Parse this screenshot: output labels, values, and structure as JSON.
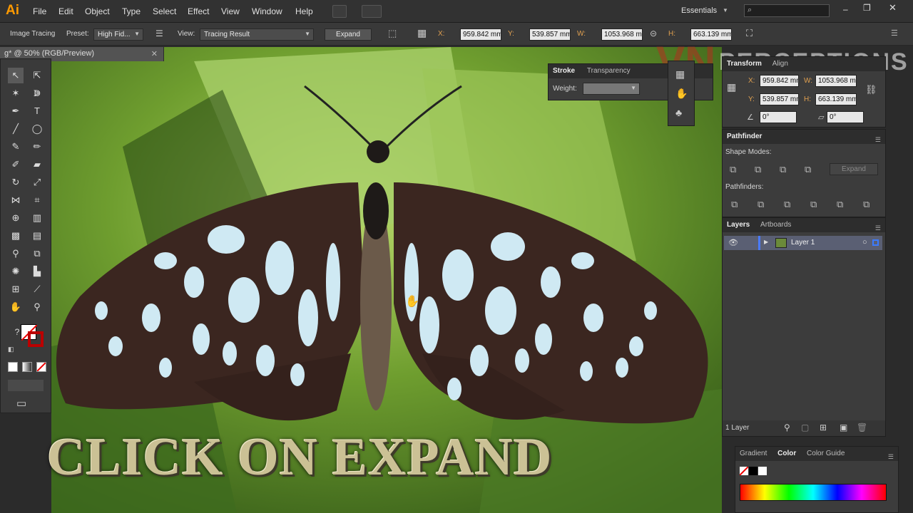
{
  "app": {
    "logo": "Ai",
    "workspace": "Essentials"
  },
  "menu": [
    "File",
    "Edit",
    "Object",
    "Type",
    "Select",
    "Effect",
    "View",
    "Window",
    "Help"
  ],
  "controlbar": {
    "mode_label": "Image Tracing",
    "preset_label": "Preset:",
    "preset_value": "High Fid...",
    "view_label": "View:",
    "view_value": "Tracing Result",
    "expand_label": "Expand",
    "x_label": "X:",
    "x_value": "959.842 mm",
    "y_label": "Y:",
    "y_value": "539.857 mm",
    "w_label": "W:",
    "w_value": "1053.968 m",
    "h_label": "H:",
    "h_value": "663.139 mm"
  },
  "document": {
    "tab_title": "g* @ 50% (RGB/Preview)"
  },
  "stroke_panel": {
    "tab_stroke": "Stroke",
    "tab_transparency": "Transparency",
    "weight_label": "Weight:"
  },
  "transform_panel": {
    "tab_transform": "Transform",
    "tab_align": "Align",
    "x_label": "X:",
    "x_value": "959.842 mm",
    "y_label": "Y:",
    "y_value": "539.857 mm",
    "w_label": "W:",
    "w_value": "1053.968 m",
    "h_label": "H:",
    "h_value": "663.139 mm",
    "angle_value": "0°",
    "shear_value": "0°"
  },
  "pathfinder_panel": {
    "title": "Pathfinder",
    "shape_modes_label": "Shape Modes:",
    "expand_label": "Expand",
    "pathfinders_label": "Pathfinders:"
  },
  "layers_panel": {
    "tab_layers": "Layers",
    "tab_artboards": "Artboards",
    "layer_name": "Layer 1",
    "footer": "1 Layer"
  },
  "color_panel": {
    "tab_gradient": "Gradient",
    "tab_color": "Color",
    "tab_color_guide": "Color Guide"
  },
  "overlay": {
    "caption": "CLICK ON EXPAND",
    "watermark_vn": "VN",
    "watermark_text": "PERCEPTIONS"
  },
  "colors": {
    "accent": "#ff9a00",
    "ui_dark": "#323232",
    "selection_blue": "#5a6fb8"
  }
}
